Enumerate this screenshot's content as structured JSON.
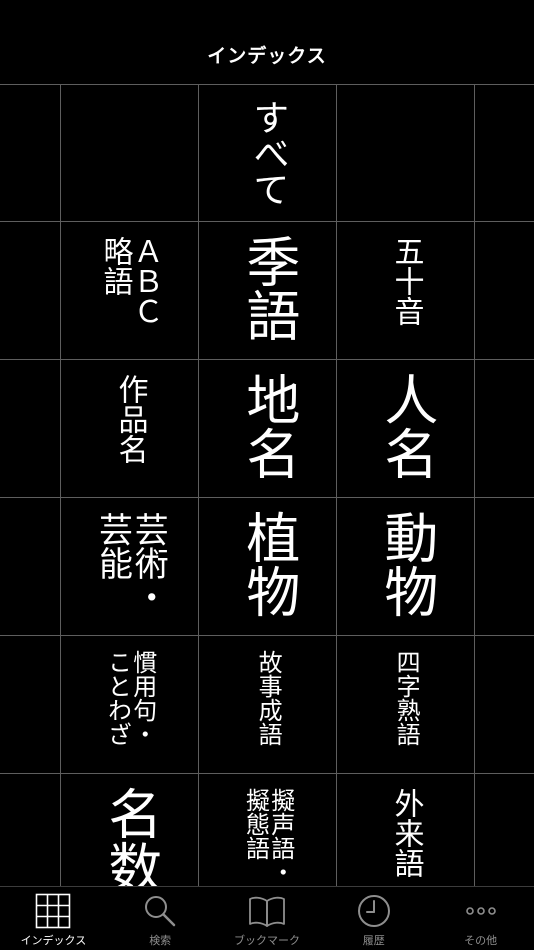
{
  "header": {
    "title": "インデックス"
  },
  "grid": {
    "cells": {
      "all": "すべて",
      "gojuon": "五十音",
      "kigo": "季語",
      "abc_ryakugo": "ＡＢＣ\n略語",
      "jinmei": "人名",
      "chimei": "地名",
      "sakuhinmei": "作品名",
      "doubutsu": "動物",
      "shokubutsu": "植物",
      "geijutsu_geino": "芸術・\n芸能",
      "yojijukugo": "四字熟語",
      "koji_seigo": "故事成語",
      "kanyoku_kotowaza": "慣用句・\nことわざ",
      "gairaigo": "外来語",
      "giseigo_gitaigo": "擬声語・\n擬態語",
      "meisushi": "名数"
    }
  },
  "tabbar": {
    "items": [
      {
        "label": "インデックス",
        "icon": "grid-icon",
        "active": true
      },
      {
        "label": "検索",
        "icon": "search-icon",
        "active": false
      },
      {
        "label": "ブックマーク",
        "icon": "book-icon",
        "active": false
      },
      {
        "label": "履歴",
        "icon": "clock-icon",
        "active": false
      },
      {
        "label": "その他",
        "icon": "more-icon",
        "active": false
      }
    ],
    "active_color": "#ffffff",
    "inactive_color": "#8e8e8e"
  }
}
